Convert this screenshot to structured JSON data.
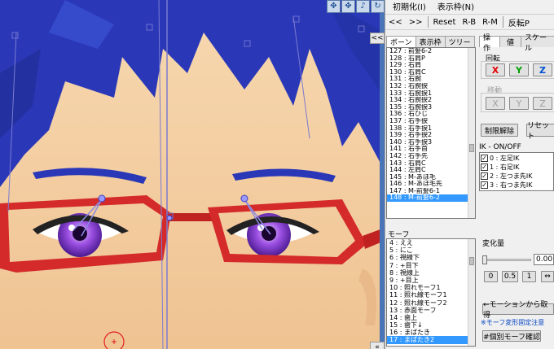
{
  "menu": {
    "items": [
      "初期化(I)",
      "表示枠(N)"
    ]
  },
  "toolbar": {
    "prev": "<<",
    "next": ">>",
    "reset": "Reset",
    "rb": "R-B",
    "rm": "R-M",
    "flip": "反転P"
  },
  "bone_tabs": [
    "ボーン",
    "表示枠",
    "ツリー"
  ],
  "bone_list": [
    "127 : 前髪6-2",
    "128 : 右肩P",
    "129 : 右肩",
    "130 : 右肩C",
    "131 : 右腕",
    "132 : 右腕捩",
    "133 : 右腕捩1",
    "134 : 右腕捩2",
    "135 : 右腕捩3",
    "136 : 右ひじ",
    "137 : 右手捩",
    "138 : 右手捩1",
    "139 : 右手捩2",
    "140 : 右手捩3",
    "141 : 右手首",
    "142 : 右手先",
    "143 : 右肩C",
    "144 : 左肩C",
    "145 : M-あほ毛",
    "146 : M-あほ毛先",
    "147 : M-前髪6-1",
    "148 : M-前髪6-2"
  ],
  "bone_selected_index": 21,
  "op_tabs": [
    "操作",
    "値",
    "スケール"
  ],
  "rotate": {
    "label": "回転",
    "x": "X",
    "y": "Y",
    "z": "Z"
  },
  "move": {
    "label": "移動",
    "x": "X",
    "y": "Y",
    "z": "Z"
  },
  "buttons": {
    "unrestrict": "制限解除",
    "reset": "リセット"
  },
  "ik": {
    "title": "IK - ON/OFF",
    "items": [
      "0 : 左足IK",
      "1 : 右足IK",
      "2 : 左つま先IK",
      "3 : 右つま先IK"
    ],
    "checked": [
      true,
      true,
      true,
      true
    ]
  },
  "morph_label": "モーフ",
  "morph_list": [
    "4 : ええ",
    "5 : にこ",
    "6 : 視線下",
    "7 : +目下",
    "8 : 視線上",
    "9 : +目上",
    "10 : 照れモーフ1",
    "11 : 照れ線モーフ1",
    "12 : 照れ線モーフ2",
    "13 : 赤面モーフ",
    "14 : 歯上",
    "15 : 歯下↓",
    "16 : まばたき",
    "17 : まばたき2"
  ],
  "morph_selected_index": 13,
  "change_amount": {
    "label": "変化量",
    "value": 0,
    "value_text": "0.00",
    "presets": [
      "0",
      "0.5",
      "1"
    ]
  },
  "motion_button": "←モーションから取得",
  "note": "※モーフ変形固定注意",
  "individual_button": "#個別モーフ確認",
  "viewport_tools": [
    "✥",
    "✥",
    "♪",
    "↻"
  ],
  "scroll_buttons": [
    "<<",
    "«"
  ],
  "colors": {
    "hair": "#2a38b8",
    "skin": "#f4cfa4",
    "glasses": "#d42a2a",
    "iris": "#8a3ad6",
    "selection": "#3399ff"
  }
}
